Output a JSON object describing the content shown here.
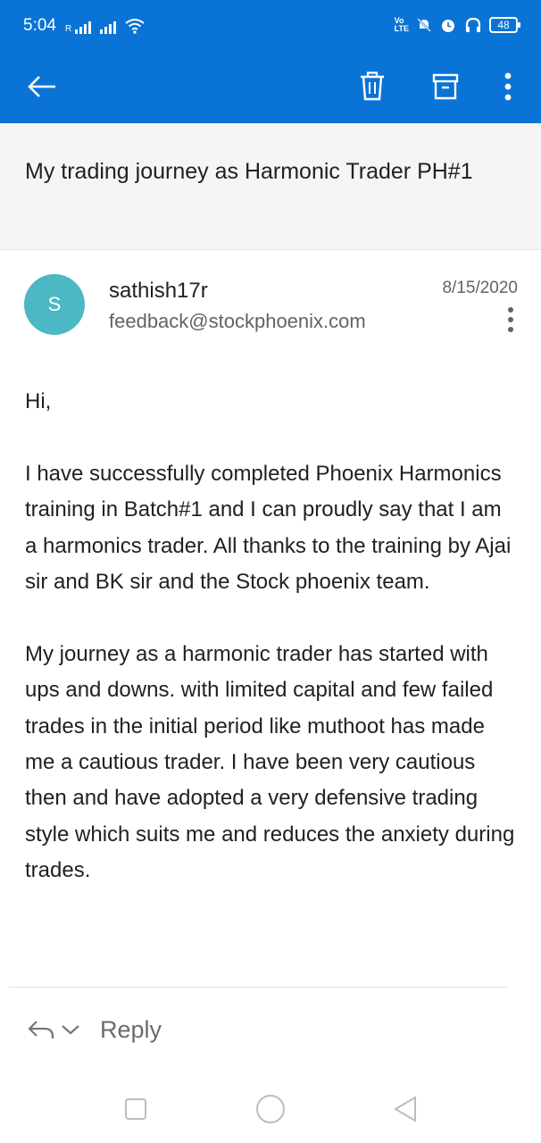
{
  "status_bar": {
    "time": "5:04",
    "roaming": "R",
    "volte": [
      "Vo",
      "LTE"
    ],
    "battery": "48"
  },
  "app_bar": {
    "accent_color": "#0a74d6",
    "icons": [
      "back-arrow-icon",
      "delete-icon",
      "archive-icon",
      "more-vertical-icon"
    ]
  },
  "email": {
    "subject": "My trading journey as Harmonic Trader PH#1",
    "sender": {
      "initial": "S",
      "name": "sathish17r",
      "email": "feedback@stockphoenix.com",
      "avatar_color": "#4cb8c4"
    },
    "date": "8/15/2020",
    "body": {
      "greeting": "Hi,",
      "paragraph1": "I have successfully completed Phoenix Harmonics training in Batch#1 and I can proudly say that I am a harmonics trader. All thanks to the training by Ajai sir and BK sir and the Stock phoenix team.",
      "paragraph2": "My journey as a harmonic trader has started with ups and downs. with limited capital and few failed trades in the initial period like muthoot has made me a cautious trader. I have been very cautious then and have adopted a very defensive trading style which suits me and reduces the anxiety during trades."
    }
  },
  "reply": {
    "label": "Reply"
  },
  "nav_bar": {
    "icons": [
      "recents-square-icon",
      "home-circle-icon",
      "back-triangle-icon"
    ]
  }
}
